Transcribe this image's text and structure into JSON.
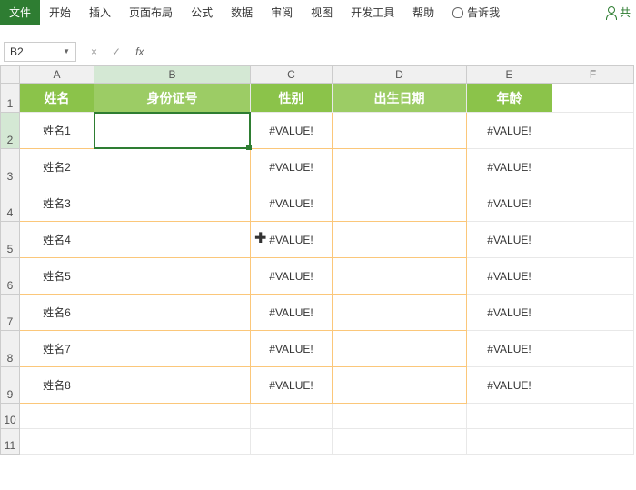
{
  "ribbon": {
    "tabs": [
      "文件",
      "开始",
      "插入",
      "页面布局",
      "公式",
      "数据",
      "审阅",
      "视图",
      "开发工具",
      "帮助"
    ],
    "tellme": "告诉我",
    "share": "共"
  },
  "formula_bar": {
    "name_box": "B2",
    "cancel": "×",
    "confirm": "✓",
    "fx": "fx",
    "value": ""
  },
  "columns": [
    "A",
    "B",
    "C",
    "D",
    "E",
    "F"
  ],
  "header_row": {
    "num": "1",
    "cells": [
      "姓名",
      "身份证号",
      "性别",
      "出生日期",
      "年龄"
    ]
  },
  "data_rows": [
    {
      "num": "2",
      "cells": [
        "姓名1",
        "",
        "#VALUE!",
        "",
        "#VALUE!"
      ]
    },
    {
      "num": "3",
      "cells": [
        "姓名2",
        "",
        "#VALUE!",
        "",
        "#VALUE!"
      ]
    },
    {
      "num": "4",
      "cells": [
        "姓名3",
        "",
        "#VALUE!",
        "",
        "#VALUE!"
      ]
    },
    {
      "num": "5",
      "cells": [
        "姓名4",
        "",
        "#VALUE!",
        "",
        "#VALUE!"
      ]
    },
    {
      "num": "6",
      "cells": [
        "姓名5",
        "",
        "#VALUE!",
        "",
        "#VALUE!"
      ]
    },
    {
      "num": "7",
      "cells": [
        "姓名6",
        "",
        "#VALUE!",
        "",
        "#VALUE!"
      ]
    },
    {
      "num": "8",
      "cells": [
        "姓名7",
        "",
        "#VALUE!",
        "",
        "#VALUE!"
      ]
    },
    {
      "num": "9",
      "cells": [
        "姓名8",
        "",
        "#VALUE!",
        "",
        "#VALUE!"
      ]
    }
  ],
  "empty_rows": [
    "10",
    "11"
  ],
  "active_cell": "B2"
}
